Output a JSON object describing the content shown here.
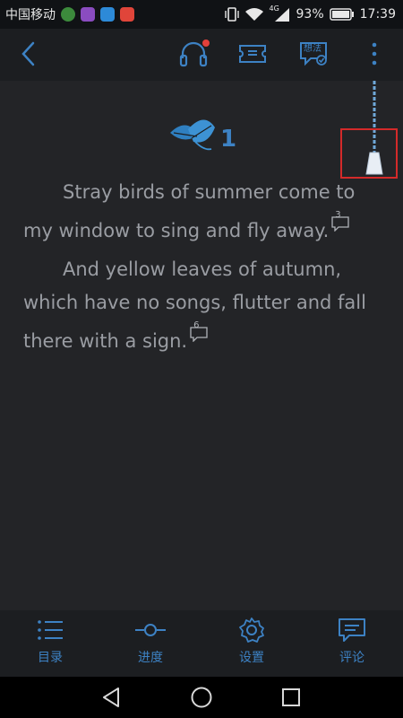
{
  "status_bar": {
    "carrier": "中国移动",
    "network": "4G",
    "battery": "93%",
    "time": "17:39"
  },
  "toolbar": {
    "back_icon": "back-chevron-icon",
    "audio_icon": "headphones-icon",
    "audio_has_notification": true,
    "ticket_icon": "ticket-icon",
    "thoughts_label": "想法",
    "more_icon": "more-vertical-icon"
  },
  "chapter": {
    "number": "1",
    "icon": "leaf-icon"
  },
  "paragraphs": [
    {
      "text": "Stray birds of summer come to my window to sing and fly away.",
      "note_count": "3"
    },
    {
      "text": "And yellow leaves of autumn, which have no songs, flutter and fall there with a sign.",
      "note_count": "6"
    }
  ],
  "bottom_nav": {
    "items": [
      {
        "label": "目录",
        "icon": "list-icon"
      },
      {
        "label": "进度",
        "icon": "progress-icon"
      },
      {
        "label": "设置",
        "icon": "gear-icon"
      },
      {
        "label": "评论",
        "icon": "comment-icon"
      }
    ]
  },
  "colors": {
    "accent": "#3d82c4",
    "background": "#232427",
    "text": "#9a9da3",
    "highlight": "#d42a2a"
  }
}
